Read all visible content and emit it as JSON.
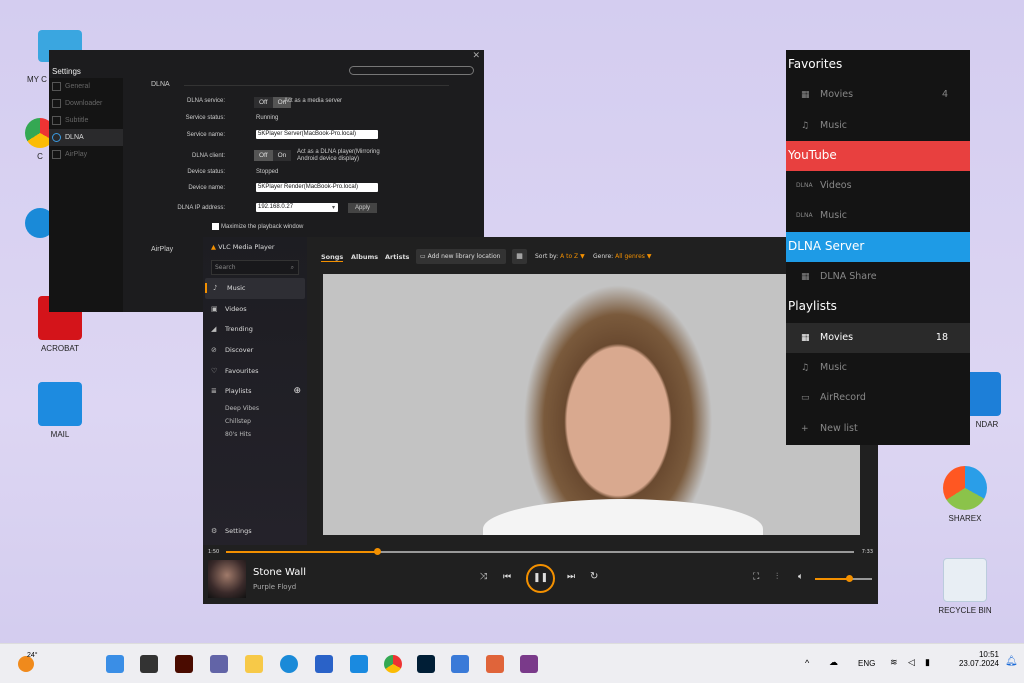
{
  "desktop": {
    "icons": [
      {
        "label": "MY C"
      },
      {
        "label": "C"
      },
      {
        "label": "ACROBAT"
      },
      {
        "label": "MAIL"
      },
      {
        "label": "NDAR"
      },
      {
        "label": "SHAREX"
      },
      {
        "label": "RECYCLE BIN"
      }
    ]
  },
  "settings": {
    "title": "Settings",
    "close": "✕",
    "nav": [
      "General",
      "Downloader",
      "Subtitle",
      "DLNA",
      "AirPlay"
    ],
    "section": "DLNA",
    "section2": "AirPlay",
    "dlna_service_label": "DLNA service:",
    "off": "Off",
    "on": "On",
    "dlna_service_desc": "Act as a media server",
    "service_status_label": "Service status:",
    "service_status": "Running",
    "service_name_label": "Service name:",
    "service_name": "5KPlayer Server(MacBook-Pro.local)",
    "dlna_client_label": "DLNA client:",
    "dlna_client_desc1": "Act as a DLNA player(Mirroring",
    "dlna_client_desc2": "Android device display)",
    "device_status_label": "Device status:",
    "device_status": "Stopped",
    "device_name_label": "Device name:",
    "device_name": "5KPlayer Render(MacBook-Pro.local)",
    "ip_label": "DLNA IP address:",
    "ip": "192.168.0.27",
    "apply": "Apply",
    "maximize": "Maximize the playback window"
  },
  "vlc": {
    "app_title": "VLC Media Player",
    "search_placeholder": "Search",
    "nav": [
      "Music",
      "Videos",
      "Trending",
      "Discover",
      "Favourites",
      "Playlists"
    ],
    "playlists": [
      "Deep Vibes",
      "Chillstep",
      "80's Hits"
    ],
    "settings": "Settings",
    "tabs": [
      "Songs",
      "Albums",
      "Artists"
    ],
    "add_library": "Add new library location",
    "sort_label": "Sort by:",
    "sort_value": "A to Z",
    "genre_label": "Genre:",
    "genre_value": "All genres",
    "elapsed": "1:50",
    "total": "7:33",
    "progress": 0.24,
    "volume": 0.6,
    "track": "Stone Wall",
    "artist": "Purple Floyd",
    "accent": "#f39000"
  },
  "panel": {
    "sections": [
      {
        "header": "Favorites",
        "color": "#141414",
        "items": [
          {
            "label": "Movies",
            "count": "4",
            "icon": "film"
          },
          {
            "label": "Music",
            "icon": "note"
          }
        ]
      },
      {
        "header": "YouTube",
        "color": "#e8403f",
        "items": [
          {
            "label": "Videos",
            "icon": "DLNA"
          },
          {
            "label": "Music",
            "icon": "DLNA"
          }
        ]
      },
      {
        "header": "DLNA Server",
        "color": "#1e9be6",
        "items": [
          {
            "label": "DLNA Share",
            "icon": "film"
          }
        ]
      },
      {
        "header": "Playlists",
        "color": "#141414",
        "items": [
          {
            "label": "Movies",
            "count": "18",
            "icon": "film"
          },
          {
            "label": "Music",
            "icon": "note"
          },
          {
            "label": "AirRecord",
            "icon": "airplay"
          },
          {
            "label": "New list",
            "icon": "plus"
          }
        ]
      }
    ]
  },
  "taskbar": {
    "weather": "24°",
    "lang": "ENG",
    "time": "10:51",
    "date": "23.07.2024"
  }
}
